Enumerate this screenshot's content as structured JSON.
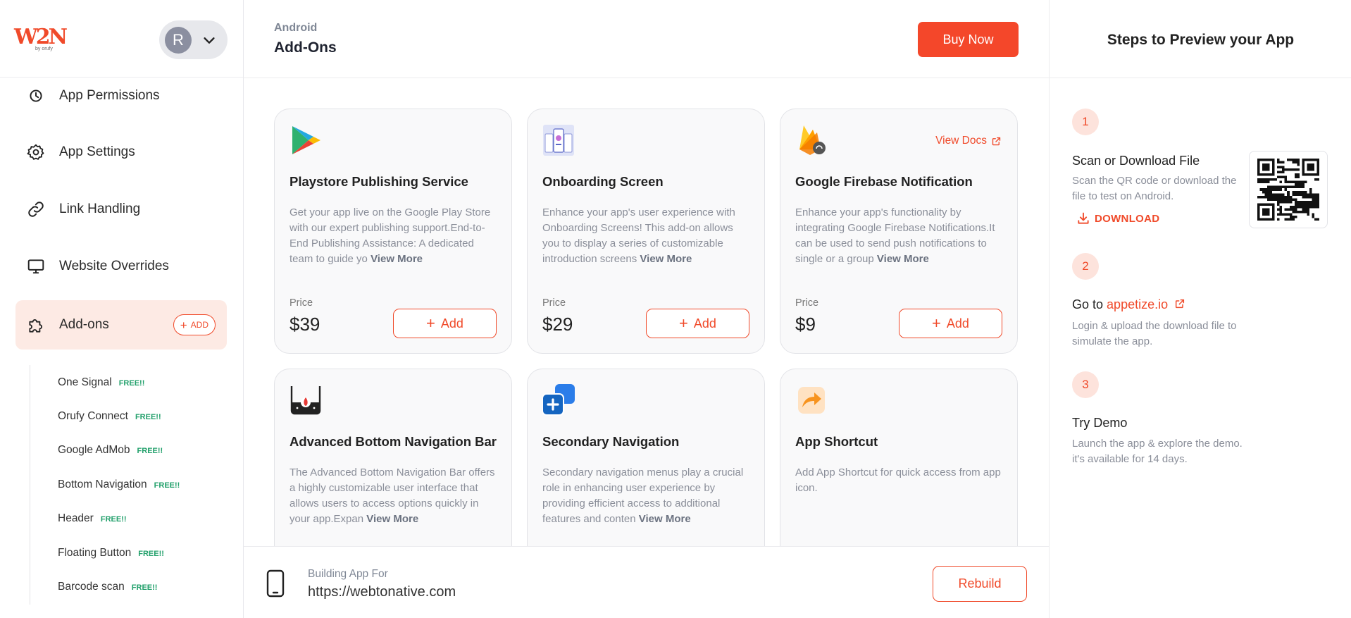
{
  "app": {
    "logo_text": "W2N",
    "logo_sub": "by orufy",
    "user_initial": "R"
  },
  "sidebar": {
    "items": [
      {
        "label": "App Permissions",
        "icon": "permissions-icon"
      },
      {
        "label": "App Settings",
        "icon": "gear-icon"
      },
      {
        "label": "Link Handling",
        "icon": "link-icon"
      },
      {
        "label": "Website Overrides",
        "icon": "monitor-icon"
      },
      {
        "label": "Add-ons",
        "icon": "puzzle-icon",
        "active": true,
        "chip": "ADD"
      }
    ],
    "subitems": [
      {
        "label": "One Signal",
        "badge": "FREE!!"
      },
      {
        "label": "Orufy Connect",
        "badge": "FREE!!"
      },
      {
        "label": "Google AdMob",
        "badge": "FREE!!"
      },
      {
        "label": "Bottom Navigation",
        "badge": "FREE!!"
      },
      {
        "label": "Header",
        "badge": "FREE!!"
      },
      {
        "label": "Floating Button",
        "badge": "FREE!!"
      },
      {
        "label": "Barcode scan",
        "badge": "FREE!!"
      }
    ]
  },
  "header": {
    "platform": "Android",
    "title": "Add-Ons",
    "buy_label": "Buy Now"
  },
  "cards": [
    {
      "title": "Playstore Publishing Service",
      "desc": "Get your app live on the Google Play Store with our expert publishing support.End-to-End Publishing Assistance: A dedicated team to guide yo",
      "view_more": "View More",
      "price_label": "Price",
      "price": "$39",
      "add_label": "Add"
    },
    {
      "title": "Onboarding Screen",
      "desc": "Enhance your app's user experience with Onboarding Screens! This add-on allows you to display a series of customizable introduction screens",
      "view_more": "View More",
      "price_label": "Price",
      "price": "$29",
      "add_label": "Add"
    },
    {
      "title": "Google Firebase Notification",
      "desc": "Enhance your app's functionality by integrating Google Firebase Notifications.It can be used to send push notifications to single or a group",
      "view_more": "View More",
      "price_label": "Price",
      "price": "$9",
      "add_label": "Add",
      "docs_label": "View Docs"
    },
    {
      "title": "Advanced Bottom Navigation Bar",
      "desc": "The Advanced Bottom Navigation Bar offers a highly customizable user interface that allows users to access options quickly in your app.Expan",
      "view_more": "View More"
    },
    {
      "title": "Secondary Navigation",
      "desc": "Secondary navigation menus play a crucial role in enhancing user experience by providing efficient access to additional features and conten",
      "view_more": "View More"
    },
    {
      "title": "App Shortcut",
      "desc": "Add App Shortcut for quick access from app icon."
    }
  ],
  "footer": {
    "building_label": "Building App For",
    "url": "https://webtonative.com",
    "rebuild_label": "Rebuild"
  },
  "preview": {
    "title": "Steps to Preview your App",
    "steps": [
      {
        "num": "1",
        "title": "Scan or Download File",
        "desc": "Scan the QR code or download the file to test on Android.",
        "action": "DOWNLOAD"
      },
      {
        "num": "2",
        "title_prefix": "Go to",
        "link": "appetize.io",
        "desc": "Login & upload the download file to simulate the app."
      },
      {
        "num": "3",
        "title": "Try Demo",
        "desc": "Launch the app & explore the demo. it's available for 14 days."
      }
    ]
  },
  "colors": {
    "accent": "#f04a2a",
    "accent_soft": "#fdeae4",
    "free_badge": "#22a06b",
    "muted_text": "#8a8e99"
  }
}
